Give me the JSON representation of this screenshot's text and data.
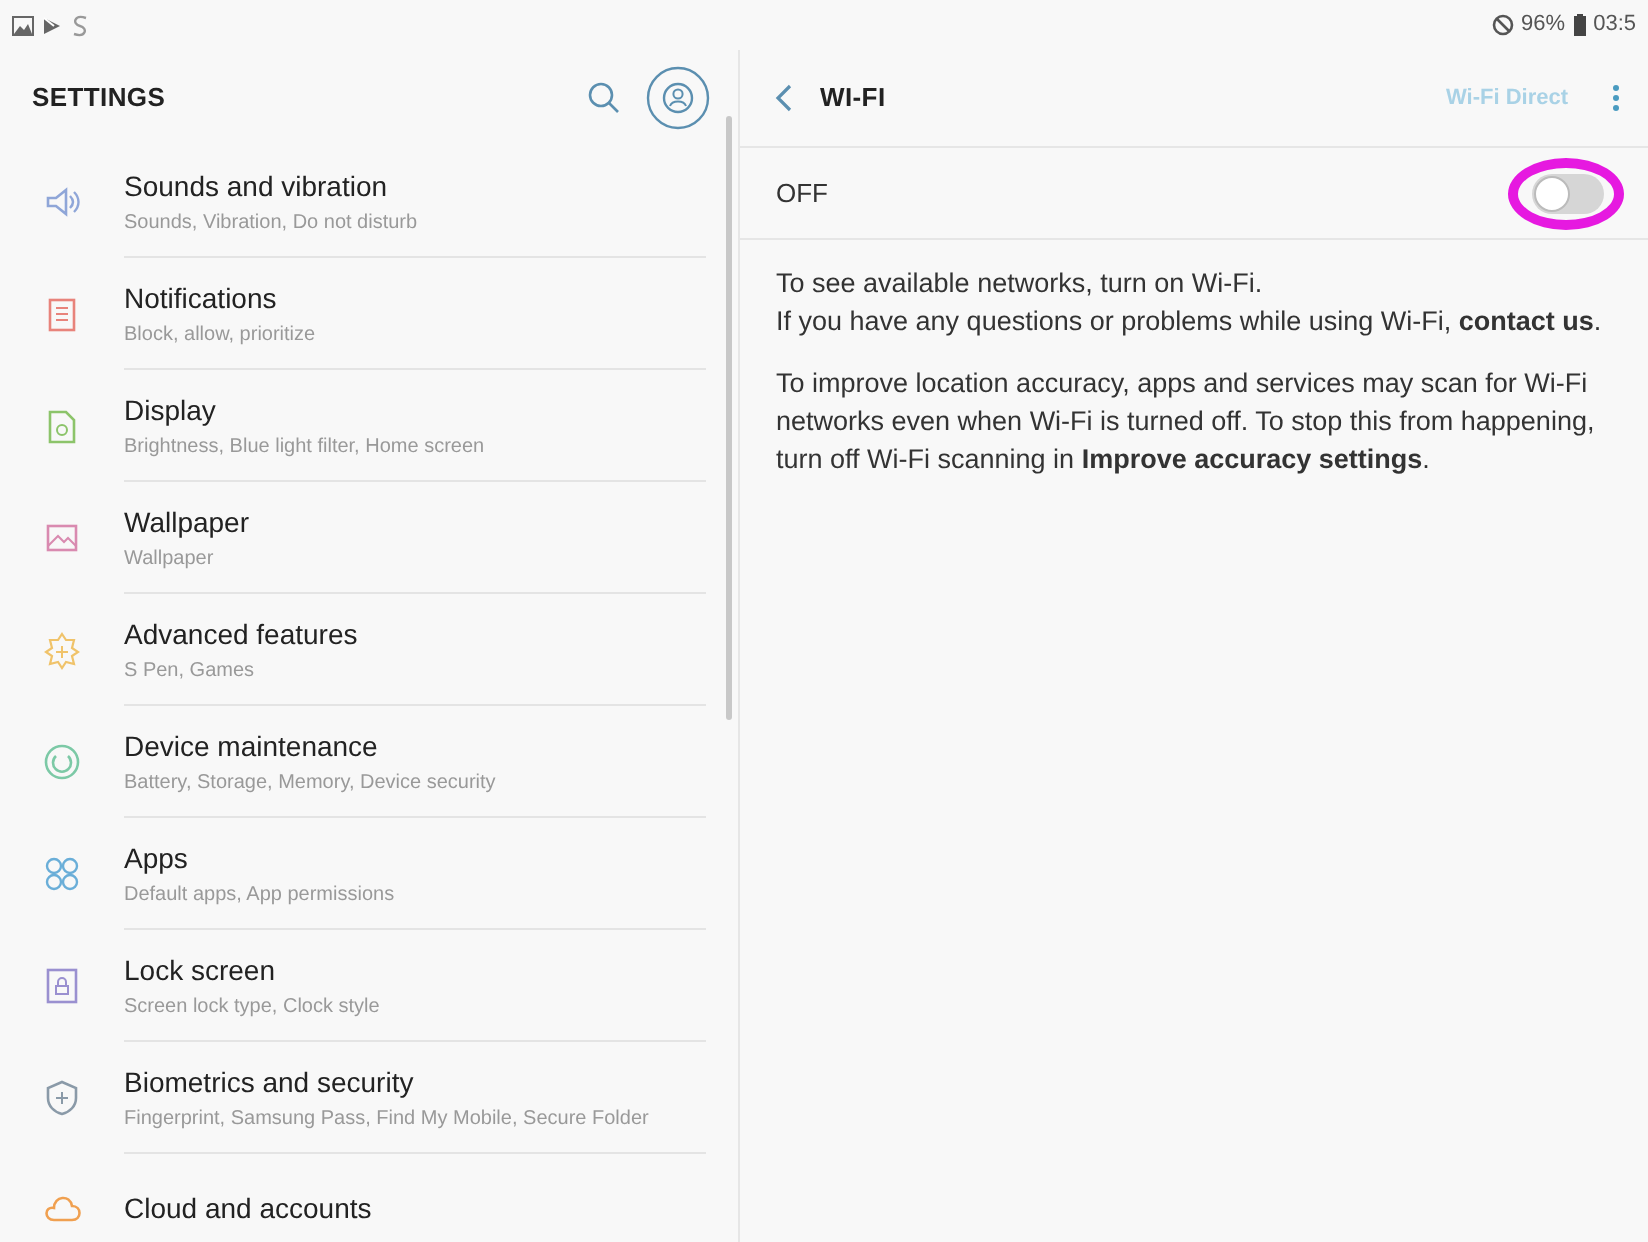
{
  "status_bar": {
    "time": "03:5",
    "battery": "96%"
  },
  "settings_header": {
    "title": "SETTINGS"
  },
  "settings_items": [
    {
      "title": "Sounds and vibration",
      "subtitle": "Sounds, Vibration, Do not disturb",
      "color": "#8fa6d8"
    },
    {
      "title": "Notifications",
      "subtitle": "Block, allow, prioritize",
      "color": "#e8837b"
    },
    {
      "title": "Display",
      "subtitle": "Brightness, Blue light filter, Home screen",
      "color": "#8cc46a"
    },
    {
      "title": "Wallpaper",
      "subtitle": "Wallpaper",
      "color": "#d98ab0"
    },
    {
      "title": "Advanced features",
      "subtitle": "S Pen, Games",
      "color": "#f0c36a"
    },
    {
      "title": "Device maintenance",
      "subtitle": "Battery, Storage, Memory, Device security",
      "color": "#7cc9a6"
    },
    {
      "title": "Apps",
      "subtitle": "Default apps, App permissions",
      "color": "#6aaed8"
    },
    {
      "title": "Lock screen",
      "subtitle": "Screen lock type, Clock style",
      "color": "#9a90d0"
    },
    {
      "title": "Biometrics and security",
      "subtitle": "Fingerprint, Samsung Pass, Find My Mobile, Secure Folder",
      "color": "#8a9aa8"
    },
    {
      "title": "Cloud and accounts",
      "color": "#f0a050"
    }
  ],
  "wifi_header": {
    "title": "WI-FI",
    "action": "Wi-Fi Direct"
  },
  "wifi_switch": {
    "label": "OFF",
    "on": false
  },
  "paragraphs": [
    {
      "lines": [
        {
          "text": "To see available networks, turn on Wi-Fi."
        },
        {
          "text": "If you have any questions or problems while using Wi-Fi, ",
          "link": "contact us",
          "after": "."
        }
      ]
    },
    {
      "lines": [
        {
          "text": "To improve location accuracy, apps and services may scan for Wi-Fi networks even when Wi-Fi is turned off. To stop this from happening, turn off Wi-Fi scanning in ",
          "link": "Improve accuracy settings",
          "after": "."
        }
      ]
    }
  ]
}
